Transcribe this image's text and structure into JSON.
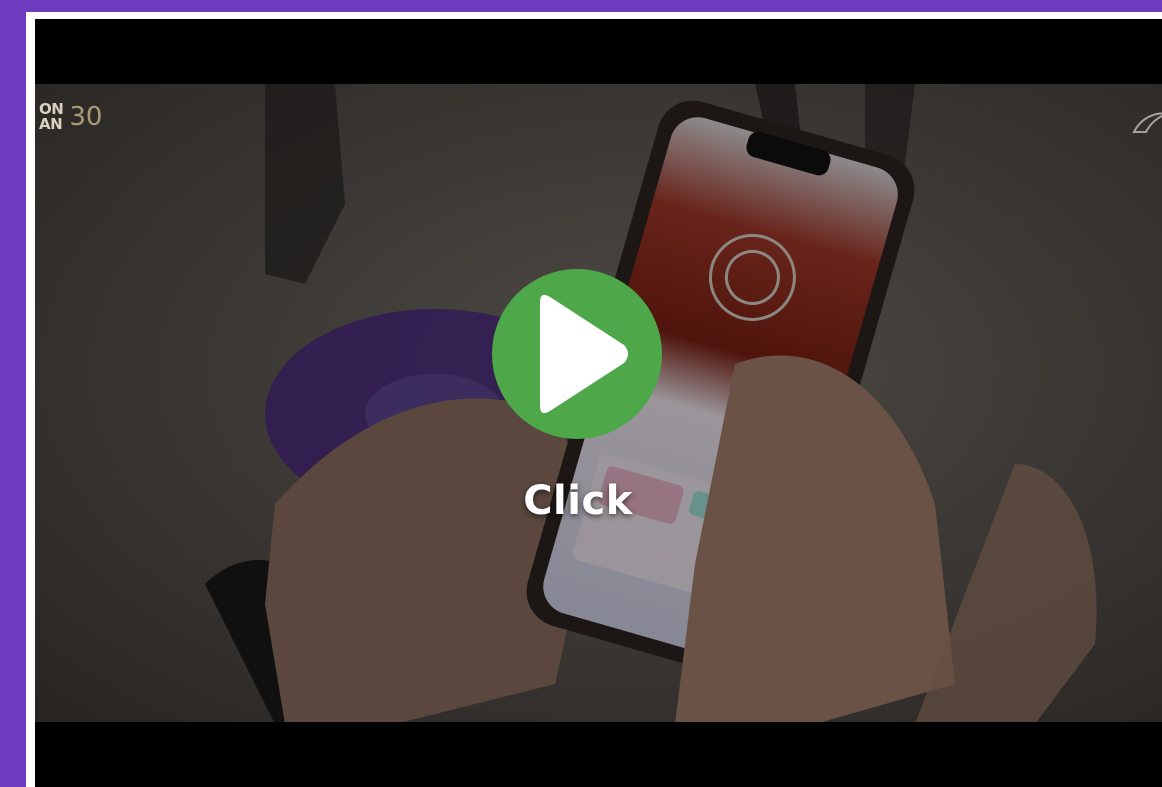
{
  "player": {
    "overlay_label": "Click",
    "play_icon": "play-icon",
    "play_color": "#4ea84a"
  },
  "video": {
    "channel_logo_text_line1": "ON",
    "channel_logo_text_line2": "AN",
    "channel_logo_mark": "30",
    "watermark_icon": "watermark-icon"
  },
  "theme": {
    "page_background": "#6f3cc0",
    "frame_background": "#ffffff",
    "player_background": "#000000"
  }
}
